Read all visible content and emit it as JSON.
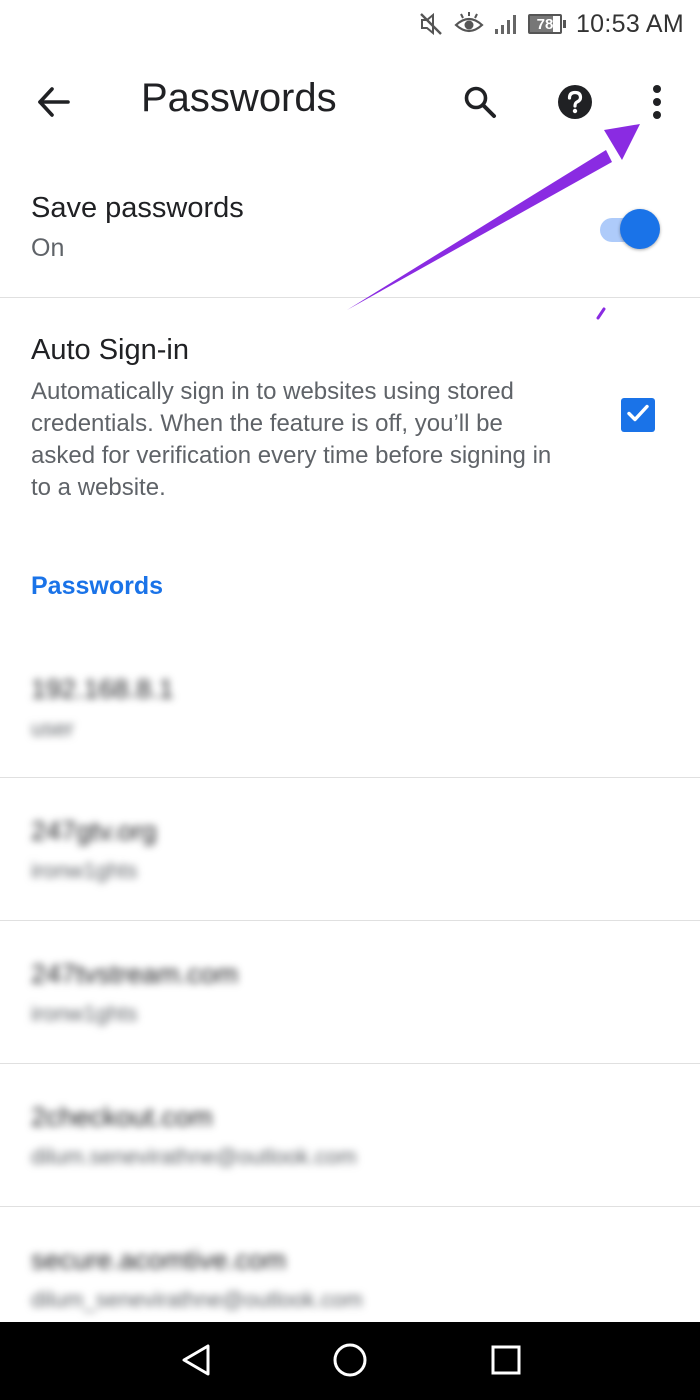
{
  "status_bar": {
    "battery_level": "78",
    "time": "10:53 AM",
    "icons": [
      "mute-icon",
      "eye-icon",
      "signal-icon",
      "battery-icon"
    ]
  },
  "app_bar": {
    "title": "Passwords",
    "icons": [
      "back-arrow-icon",
      "search-icon",
      "help-icon",
      "more-vert-icon"
    ]
  },
  "save_passwords": {
    "title": "Save passwords",
    "status": "On",
    "toggle_on": true
  },
  "auto_signin": {
    "title": "Auto Sign-in",
    "description": "Automatically sign in to websites using stored credentials. When the feature is off, you’ll be asked for verification every time before signing in to a website.",
    "checked": true
  },
  "passwords_section": {
    "header": "Passwords",
    "items": [
      {
        "site": "192.168.8.1",
        "user": "user"
      },
      {
        "site": "247gtv.org",
        "user": "ironw1ghts"
      },
      {
        "site": "247tvstream.com",
        "user": "ironw1ghts"
      },
      {
        "site": "2checkout.com",
        "user": "dilum.senevirathne@outlook.com"
      },
      {
        "site": "secure.acomtive.com",
        "user": "dilum_senevirathne@outlook.com"
      }
    ]
  },
  "colors": {
    "accent": "#1a73e8",
    "annotation_arrow": "#8a2be2",
    "nav_bar": "#000000"
  },
  "nav_bar": {
    "icons": [
      "nav-back-icon",
      "nav-home-icon",
      "nav-recents-icon"
    ]
  }
}
